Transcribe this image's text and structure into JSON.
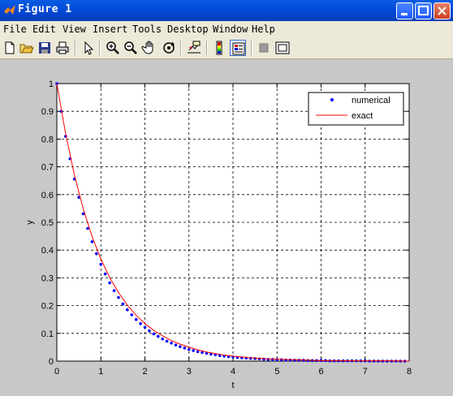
{
  "window": {
    "title": "Figure 1"
  },
  "menu": [
    "File",
    "Edit",
    "View",
    "Insert",
    "Tools",
    "Desktop",
    "Window",
    "Help"
  ],
  "toolbar": [
    "new-icon",
    "open-icon",
    "save-icon",
    "print-icon",
    "pointer-icon",
    "zoom-in-icon",
    "zoom-out-icon",
    "pan-icon",
    "rotate-icon",
    "data-cursor-icon",
    "colorbar-icon",
    "legend-icon",
    "hide-plot-tools-icon",
    "show-plot-tools-icon"
  ],
  "chart_data": {
    "type": "line",
    "xlabel": "t",
    "ylabel": "y",
    "xlim": [
      0,
      8
    ],
    "ylim": [
      0,
      1
    ],
    "xticks": [
      "0",
      "1",
      "2",
      "3",
      "4",
      "5",
      "6",
      "7",
      "8"
    ],
    "yticks": [
      "0",
      "0.1",
      "0.2",
      "0.3",
      "0.4",
      "0.5",
      "0.6",
      "0.7",
      "0.8",
      "0.9",
      "1"
    ],
    "grid": true,
    "legend_position": "top-right",
    "legend": [
      "numerical",
      "exact"
    ],
    "series": [
      {
        "name": "numerical",
        "style": "dots",
        "color": "#0000ff",
        "x": [
          0,
          0.1,
          0.2,
          0.3,
          0.4,
          0.5,
          0.6,
          0.7,
          0.8,
          0.9,
          1.0,
          1.1,
          1.2,
          1.3,
          1.4,
          1.5,
          1.6,
          1.7,
          1.8,
          1.9,
          2.0,
          2.1,
          2.2,
          2.3,
          2.4,
          2.5,
          2.6,
          2.7,
          2.8,
          2.9,
          3.0,
          3.1,
          3.2,
          3.3,
          3.4,
          3.5,
          3.6,
          3.7,
          3.8,
          3.9,
          4.0,
          4.1,
          4.2,
          4.3,
          4.4,
          4.5,
          4.6,
          4.7,
          4.8,
          4.9,
          5.0,
          5.1,
          5.2,
          5.3,
          5.4,
          5.5,
          5.6,
          5.7,
          5.8,
          5.9,
          6.0,
          6.1,
          6.2,
          6.3,
          6.4,
          6.5,
          6.6,
          6.7,
          6.8,
          6.9,
          7.0,
          7.1,
          7.2,
          7.3,
          7.4,
          7.5,
          7.6,
          7.7,
          7.8,
          7.9
        ],
        "y": [
          1,
          0.9,
          0.81,
          0.729,
          0.656,
          0.59,
          0.531,
          0.478,
          0.43,
          0.387,
          0.349,
          0.314,
          0.282,
          0.254,
          0.229,
          0.206,
          0.185,
          0.167,
          0.15,
          0.135,
          0.122,
          0.109,
          0.098,
          0.089,
          0.08,
          0.072,
          0.065,
          0.058,
          0.052,
          0.047,
          0.042,
          0.038,
          0.034,
          0.031,
          0.028,
          0.025,
          0.023,
          0.02,
          0.018,
          0.016,
          0.015,
          0.013,
          0.012,
          0.011,
          0.01,
          0.009,
          0.008,
          0.007,
          0.006,
          0.006,
          0.005,
          0.005,
          0.004,
          0.004,
          0.003,
          0.003,
          0.003,
          0.002,
          0.002,
          0.002,
          0.002,
          0.002,
          0.001,
          0.001,
          0.001,
          0.001,
          0.001,
          0.001,
          0.001,
          0.001,
          0.001,
          0,
          0,
          0,
          0,
          0,
          0,
          0,
          0,
          0
        ]
      },
      {
        "name": "exact",
        "style": "line",
        "color": "#ff0000",
        "x": [
          0,
          0.2,
          0.4,
          0.6,
          0.8,
          1.0,
          1.2,
          1.4,
          1.6,
          1.8,
          2.0,
          2.2,
          2.4,
          2.6,
          2.8,
          3.0,
          3.2,
          3.4,
          3.6,
          3.8,
          4.0,
          4.4,
          4.8,
          5.2,
          5.6,
          6.0,
          6.4,
          6.8,
          7.2,
          7.6,
          8.0
        ],
        "y": [
          1,
          0.819,
          0.67,
          0.549,
          0.449,
          0.368,
          0.301,
          0.247,
          0.202,
          0.165,
          0.135,
          0.111,
          0.091,
          0.074,
          0.061,
          0.05,
          0.041,
          0.033,
          0.027,
          0.022,
          0.018,
          0.012,
          0.008,
          0.006,
          0.004,
          0.002,
          0.002,
          0.001,
          0.001,
          0.001,
          0
        ]
      }
    ]
  }
}
